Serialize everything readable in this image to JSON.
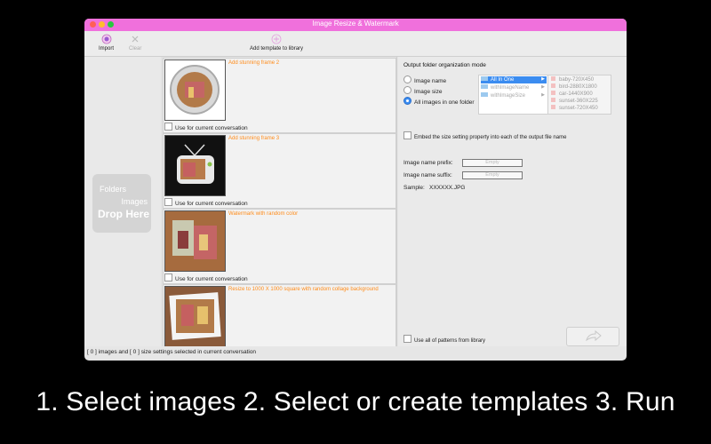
{
  "window": {
    "title": "Image Resize & Watermark"
  },
  "toolbar": {
    "import_label": "Import",
    "clear_label": "Clear",
    "add_template_label": "Add template to library"
  },
  "dropzone": {
    "line1": "Folders",
    "line2": "Images",
    "line3": "Drop Here"
  },
  "templates": [
    {
      "title": "Add stunning frame 2",
      "use_label": "Use for current conversation"
    },
    {
      "title": "Add stunning frame 3",
      "use_label": "Use for current conversation"
    },
    {
      "title": "Watermark with random color",
      "use_label": "Use for current conversation"
    },
    {
      "title": "Resize to 1000 X 1000 square with random collage background",
      "use_label": ""
    }
  ],
  "output": {
    "header": "Output folder organization mode",
    "radios": [
      {
        "label": "Image name",
        "checked": false
      },
      {
        "label": "Image size",
        "checked": false
      },
      {
        "label": "All images in one folder",
        "checked": true
      }
    ],
    "options": [
      {
        "label": "All In One",
        "selected": true
      },
      {
        "label": "withImageName",
        "selected": false
      },
      {
        "label": "withImageSize",
        "selected": false
      }
    ],
    "files": [
      "baby-720X450",
      "bird-2880X1800",
      "car-1440X900",
      "sunset-360X225",
      "sunset-720X450"
    ],
    "embed_label": "Embed the size setting property into each of the output file name",
    "prefix_label": "Image name prefix:",
    "prefix_placeholder": "Empty",
    "suffix_label": "Image name suffix:",
    "suffix_placeholder": "Empty",
    "sample_label": "Sample:",
    "sample_value": "XXXXXX.JPG",
    "use_all_label": "Use all of patterns from library"
  },
  "status": "[ 0 ] images and [ 0 ] size settings selected in current conversation",
  "caption": "1. Select images  2. Select or create templates  3. Run",
  "colors": {
    "titlebar": "#f070dc",
    "accent": "#3b8cf0",
    "template_title": "#ff8c1a"
  }
}
